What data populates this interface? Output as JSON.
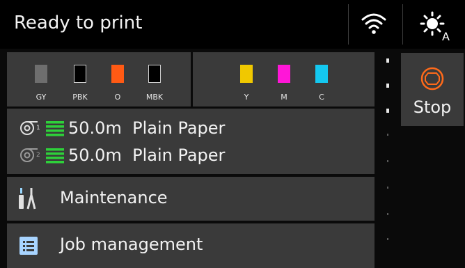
{
  "status": {
    "text": "Ready to print",
    "wifi_icon": "wifi-icon",
    "mode_icon": "auto-brightness-icon"
  },
  "ink_left": [
    {
      "label": "GY",
      "color": "#6e6e6e"
    },
    {
      "label": "PBK",
      "color": "#000000"
    },
    {
      "label": "O",
      "color": "#ff5a14"
    },
    {
      "label": "MBK",
      "color": "#000000"
    }
  ],
  "ink_right": [
    {
      "label": "Y",
      "color": "#f0c800"
    },
    {
      "label": "M",
      "color": "#ff16d8"
    },
    {
      "label": "C",
      "color": "#14c8f0"
    }
  ],
  "paper": [
    {
      "roll": "1",
      "length": "50.0m",
      "type": "Plain Paper"
    },
    {
      "roll": "2",
      "length": "50.0m",
      "type": "Plain Paper"
    }
  ],
  "menu": {
    "maintenance": "Maintenance",
    "job_management": "Job management"
  },
  "stop": {
    "label": "Stop",
    "color": "#ff6a1a"
  }
}
